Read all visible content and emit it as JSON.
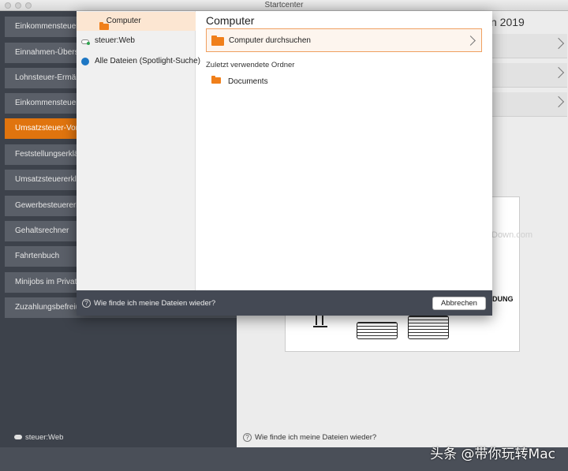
{
  "window": {
    "title": "Startcenter"
  },
  "sidebar": {
    "items": [
      {
        "label": "Einkommensteuere"
      },
      {
        "label": "Einnahmen-Übersc"
      },
      {
        "label": "Lohnsteuer-Ermäßi"
      },
      {
        "label": "Einkommensteuer-V"
      },
      {
        "label": "Umsatzsteuer-Vora",
        "active": true
      },
      {
        "label": "Feststellungserklär"
      },
      {
        "label": "Umsatzsteuererklä"
      },
      {
        "label": "Gewerbesteuererkl"
      },
      {
        "label": "Gehaltsrechner"
      },
      {
        "label": "Fahrtenbuch"
      },
      {
        "label": "Minijobs im Privath"
      },
      {
        "label": "Zuzahlungsbefreiu"
      }
    ],
    "footer": "steuer:Web"
  },
  "right_pane": {
    "title_partial": "n 2019",
    "illustration_text": "DUNG",
    "footer": "Wie finde ich meine Dateien wieder?",
    "watermark": "www.MacDown.com"
  },
  "modal": {
    "sidebar": [
      {
        "label": "Computer",
        "icon": "folder-icon",
        "active": true
      },
      {
        "label": "steuer:Web",
        "icon": "cloud-icon"
      },
      {
        "label": "Alle Dateien (Spotlight-Suche)",
        "icon": "spotlight-icon"
      }
    ],
    "title": "Computer",
    "search_label": "Computer durchsuchen",
    "recent_heading": "Zuletzt verwendete Ordner",
    "recent_items": [
      {
        "label": "Documents"
      }
    ],
    "footer_help": "Wie finde ich meine Dateien wieder?",
    "cancel_label": "Abbrechen"
  },
  "overlay_brand": "头条 @带你玩转Mac",
  "colors": {
    "accent": "#e0740e",
    "folder": "#f07f1a",
    "sidebar_bg": "#3d424b"
  }
}
